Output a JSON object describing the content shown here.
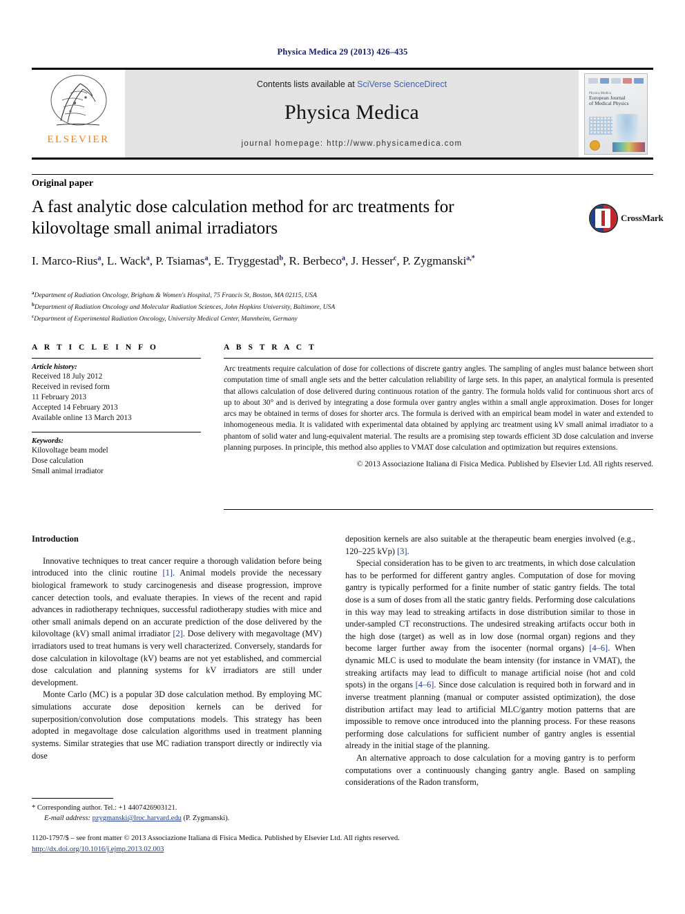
{
  "running_head": "Physica Medica 29 (2013) 426–435",
  "masthead": {
    "publisher_name": "ELSEVIER",
    "contents_prefix": "Contents lists available at ",
    "contents_link": "SciVerse ScienceDirect",
    "journal_title": "Physica Medica",
    "homepage": "journal homepage: http://www.physicamedica.com",
    "cover": {
      "series": "Physica Medica",
      "title_line1": "European Journal",
      "title_line2": "of Medical Physics"
    }
  },
  "article": {
    "type": "Original paper",
    "title": "A fast analytic dose calculation method for arc treatments for kilovoltage small animal irradiators",
    "crossmark_label": "CrossMark"
  },
  "authors": [
    {
      "name": "I. Marco-Rius",
      "sup": "a",
      "sep": ", "
    },
    {
      "name": "L. Wack",
      "sup": "a",
      "sep": ", "
    },
    {
      "name": "P. Tsiamas",
      "sup": "a",
      "sep": ", "
    },
    {
      "name": "E. Tryggestad",
      "sup": "b",
      "sep": ", "
    },
    {
      "name": "R. Berbeco",
      "sup": "a",
      "sep": ", "
    },
    {
      "name": "J. Hesser",
      "sup": "c",
      "sep": ", "
    },
    {
      "name": "P. Zygmanski",
      "sup": "a,*",
      "sep": ""
    }
  ],
  "affiliations": [
    {
      "mark": "a",
      "text": "Department of Radiation Oncology, Brigham & Women's Hospital, 75 Francis St, Boston, MA 02115, USA"
    },
    {
      "mark": "b",
      "text": "Department of Radiation Oncology and Molecular Radiation Sciences, John Hopkins University, Baltimore, USA"
    },
    {
      "mark": "c",
      "text": "Department of Experimental Radiation Oncology, University Medical Center, Mannheim, Germany"
    }
  ],
  "article_info": {
    "heading": "A R T I C L E   I N F O",
    "history_label": "Article history:",
    "history": [
      "Received 18 July 2012",
      "Received in revised form",
      "11 February 2013",
      "Accepted 14 February 2013",
      "Available online 13 March 2013"
    ],
    "keywords_label": "Keywords:",
    "keywords": [
      "Kilovoltage beam model",
      "Dose calculation",
      "Small animal irradiator"
    ]
  },
  "abstract": {
    "heading": "A B S T R A C T",
    "text": "Arc treatments require calculation of dose for collections of discrete gantry angles. The sampling of angles must balance between short computation time of small angle sets and the better calculation reliability of large sets. In this paper, an analytical formula is presented that allows calculation of dose delivered during continuous rotation of the gantry. The formula holds valid for continuous short arcs of up to about 30° and is derived by integrating a dose formula over gantry angles within a small angle approximation. Doses for longer arcs may be obtained in terms of doses for shorter arcs. The formula is derived with an empirical beam model in water and extended to inhomogeneous media. It is validated with experimental data obtained by applying arc treatment using kV small animal irradiator to a phantom of solid water and lung-equivalent material. The results are a promising step towards efficient 3D dose calculation and inverse planning purposes. In principle, this method also applies to VMAT dose calculation and optimization but requires extensions.",
    "copyright": "© 2013 Associazione Italiana di Fisica Medica. Published by Elsevier Ltd. All rights reserved."
  },
  "body": {
    "intro_heading": "Introduction",
    "left_paragraphs": [
      "Innovative techniques to treat cancer require a thorough validation before being introduced into the clinic routine [1]. Animal models provide the necessary biological framework to study carcinogenesis and disease progression, improve cancer detection tools, and evaluate therapies. In views of the recent and rapid advances in radiotherapy techniques, successful radiotherapy studies with mice and other small animals depend on an accurate prediction of the dose delivered by the kilovoltage (kV) small animal irradiator [2]. Dose delivery with megavoltage (MV) irradiators used to treat humans is very well characterized. Conversely, standards for dose calculation in kilovoltage (kV) beams are not yet established, and commercial dose calculation and planning systems for kV irradiators are still under development.",
      "Monte Carlo (MC) is a popular 3D dose calculation method. By employing MC simulations accurate dose deposition kernels can be derived for superposition/convolution dose computations models. This strategy has been adopted in megavoltage dose calculation algorithms used in treatment planning systems. Similar strategies that use MC radiation transport directly or indirectly via dose"
    ],
    "right_paragraphs": [
      "deposition kernels are also suitable at the therapeutic beam energies involved (e.g., 120–225 kVp) [3].",
      "Special consideration has to be given to arc treatments, in which dose calculation has to be performed for different gantry angles. Computation of dose for moving gantry is typically performed for a finite number of static gantry fields. The total dose is a sum of doses from all the static gantry fields. Performing dose calculations in this way may lead to streaking artifacts in dose distribution similar to those in under-sampled CT reconstructions. The undesired streaking artifacts occur both in the high dose (target) as well as in low dose (normal organ) regions and they become larger further away from the isocenter (normal organs) [4–6]. When dynamic MLC is used to modulate the beam intensity (for instance in VMAT), the streaking artifacts may lead to difficult to manage artificial noise (hot and cold spots) in the organs [4–6]. Since dose calculation is required both in forward and in inverse treatment planning (manual or computer assisted optimization), the dose distribution artifact may lead to artificial MLC/gantry motion patterns that are impossible to remove once introduced into the planning process. For these reasons performing dose calculations for sufficient number of gantry angles is essential already in the initial stage of the planning.",
      "An alternative approach to dose calculation for a moving gantry is to perform computations over a continuously changing gantry angle. Based on sampling considerations of the Radon transform,"
    ]
  },
  "footnote": {
    "corresponding": "* Corresponding author. Tel.: +1 4407426903121.",
    "email_label": "E-mail address:",
    "email": "pzygmanski@lroc.harvard.edu",
    "email_owner": "(P. Zygmanski)."
  },
  "page_footer": {
    "issn_line": "1120-1797/$ – see front matter © 2013 Associazione Italiana di Fisica Medica. Published by Elsevier Ltd. All rights reserved.",
    "doi": "http://dx.doi.org/10.1016/j.ejmp.2013.02.003"
  }
}
